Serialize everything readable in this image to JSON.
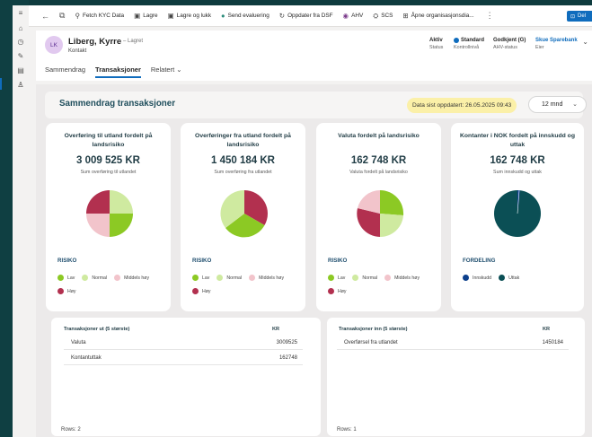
{
  "command_bar": {
    "fetch_kyc": "Fetch KYC Data",
    "save": "Lagre",
    "save_close": "Lagre og lukk",
    "send_eval": "Send evaluering",
    "refresh_dsf": "Oppdater fra DSF",
    "ahv": "AHV",
    "scs": "SCS",
    "open_org": "Åpne organisasjonsdia...",
    "share": "Del"
  },
  "record": {
    "initials": "LK",
    "name": "Liberg, Kyrre",
    "saved_status": "– Lagret",
    "type": "Kontakt",
    "fields": [
      {
        "value": "Aktiv",
        "label": "Status"
      },
      {
        "value": "Standard",
        "label": "Kontrollnivå"
      },
      {
        "value": "Godkjent (G)",
        "label": "AHV-status"
      },
      {
        "value": "Skue Sparebank",
        "label": "Eier"
      }
    ]
  },
  "tabs": [
    "Sammendrag",
    "Transaksjoner",
    "Relatert"
  ],
  "summary": {
    "title": "Sammendrag transaksjoner",
    "last_updated": "Data sist oppdatert: 26.05.2025 09:43",
    "period": "12 mnd"
  },
  "colors": {
    "lav": "#8cc924",
    "normal": "#cfeaa0",
    "middels_hoy": "#f2c4cb",
    "hoy": "#b2304f",
    "innskudd": "#0d3f8c",
    "uttak": "#0b4f55"
  },
  "cards": [
    {
      "title": "Overføring til utland fordelt på landsrisiko",
      "value": "3 009 525 KR",
      "subtitle": "Sum overføring til utlandet",
      "legend_title": "RISIKO",
      "legend": [
        {
          "label": "Lav",
          "color": "#8cc924"
        },
        {
          "label": "Normal",
          "color": "#cfeaa0"
        },
        {
          "label": "Middels høy",
          "color": "#f2c4cb"
        },
        {
          "label": "Høy",
          "color": "#b2304f"
        }
      ]
    },
    {
      "title": "Overføringer fra utland fordelt på landsrisiko",
      "value": "1 450 184 KR",
      "subtitle": "Sum overføring fra utlandet",
      "legend_title": "RISIKO",
      "legend": [
        {
          "label": "Lav",
          "color": "#8cc924"
        },
        {
          "label": "Normal",
          "color": "#cfeaa0"
        },
        {
          "label": "Middels høy",
          "color": "#f2c4cb"
        },
        {
          "label": "Høy",
          "color": "#b2304f"
        }
      ]
    },
    {
      "title": "Valuta fordelt på landsrisiko",
      "value": "162 748 KR",
      "subtitle": "Valuta fordelt på landsrisiko",
      "legend_title": "RISIKO",
      "legend": [
        {
          "label": "Lav",
          "color": "#8cc924"
        },
        {
          "label": "Normal",
          "color": "#cfeaa0"
        },
        {
          "label": "Middels høy",
          "color": "#f2c4cb"
        },
        {
          "label": "Høy",
          "color": "#b2304f"
        }
      ]
    },
    {
      "title": "Kontanter i NOK fordelt på innskudd og uttak",
      "value": "162 748 KR",
      "subtitle": "Sum innskudd og uttak",
      "legend_title": "FORDELING",
      "legend": [
        {
          "label": "Innskudd",
          "color": "#0d3f8c"
        },
        {
          "label": "Uttak",
          "color": "#0b4f55"
        }
      ]
    }
  ],
  "tables": [
    {
      "header_name": "Transaksjoner ut (5 største)",
      "header_amount": "KR",
      "rows": [
        {
          "name": "Valuta",
          "amount": "3009525"
        },
        {
          "name": "Kontantuttak",
          "amount": "162748"
        }
      ],
      "rows_count": "Rows: 2"
    },
    {
      "header_name": "Transaksjoner inn (5 største)",
      "header_amount": "KR",
      "rows": [
        {
          "name": "Overførsel fra utlandet",
          "amount": "1450184"
        }
      ],
      "rows_count": "Rows: 1"
    }
  ]
}
